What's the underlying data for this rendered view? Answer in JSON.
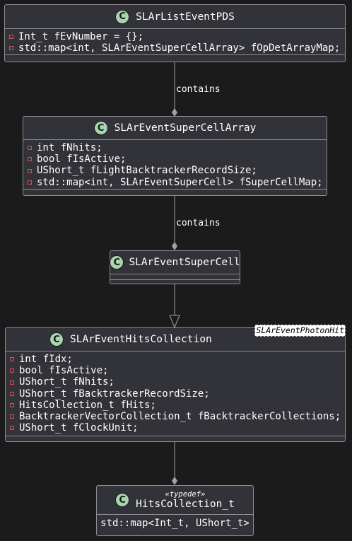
{
  "diagram": {
    "classes": {
      "list_event_pds": {
        "badge": "C",
        "name": "SLArListEventPDS",
        "attributes": [
          "Int_t fEvNumber = {};",
          "std::map<int, SLArEventSuperCellArray> fOpDetArrayMap;"
        ]
      },
      "super_cell_array": {
        "badge": "C",
        "name": "SLArEventSuperCellArray",
        "attributes": [
          "int fNhits;",
          "bool fIsActive;",
          "UShort_t fLightBacktrackerRecordSize;",
          "std::map<int, SLArEventSuperCell> fSuperCellMap;"
        ]
      },
      "super_cell": {
        "badge": "C",
        "name": "SLArEventSuperCell",
        "attributes": []
      },
      "hits_collection": {
        "badge": "C",
        "name": "SLArEventHitsCollection",
        "template": "SLArEventPhotonHit",
        "attributes": [
          "int fIdx;",
          "bool fIsActive;",
          "UShort_t fNhits;",
          "UShort_t fBacktrackerRecordSize;",
          "HitsCollection_t fHits;",
          "BacktrackerVectorCollection_t fBacktrackerCollections;",
          "UShort_t fClockUnit;"
        ]
      },
      "hits_collection_t": {
        "badge": "C",
        "stereotype": "«typedef»",
        "name": "HitsCollection_t",
        "body": "std::map<Int_t, UShort_t>"
      }
    },
    "relations": [
      {
        "label": "contains"
      },
      {
        "label": "contains"
      }
    ],
    "colors": {
      "background": "#1b1b1b",
      "class_fill": "#323239",
      "class_border": "#8d8d94",
      "badge": "#a9d4b0",
      "private_marker": "#d84f4f",
      "line": "#a0a0a6"
    }
  }
}
